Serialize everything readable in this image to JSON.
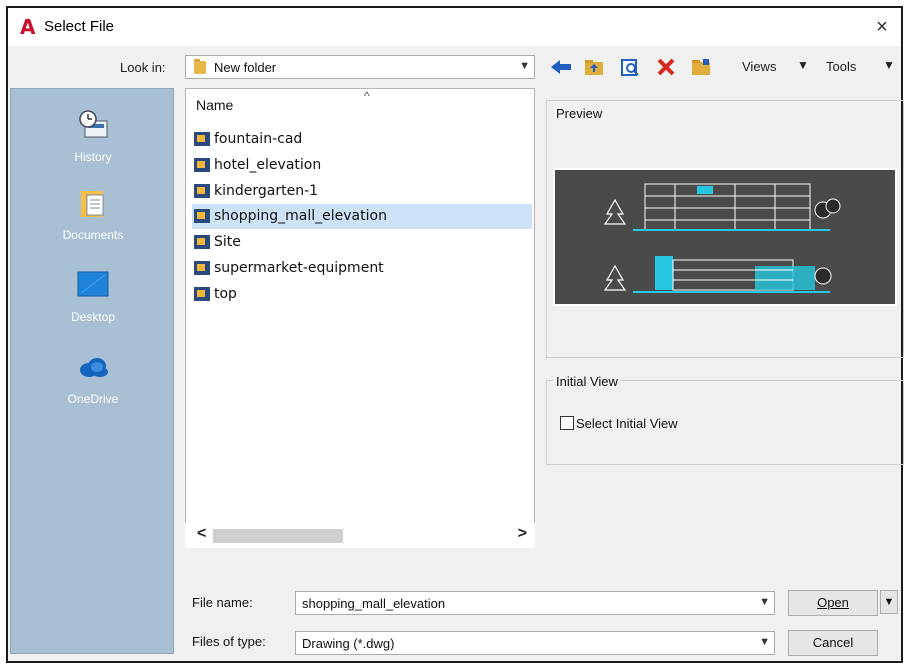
{
  "window": {
    "app_logo": "A",
    "title": "Select File",
    "close_glyph": "×"
  },
  "toolbar": {
    "look_in_label": "Look in:",
    "look_in_value": "New folder",
    "views_label": "Views",
    "tools_label": "Tools",
    "icons": [
      "back-arrow-icon",
      "up-folder-icon",
      "search-web-icon",
      "delete-icon",
      "create-folder-icon"
    ]
  },
  "places": [
    {
      "label": "History",
      "icon": "history-icon"
    },
    {
      "label": "Documents",
      "icon": "documents-icon"
    },
    {
      "label": "Desktop",
      "icon": "desktop-icon"
    },
    {
      "label": "OneDrive",
      "icon": "onedrive-icon"
    }
  ],
  "file_list": {
    "column_header": "Name",
    "files": [
      {
        "name": "fountain-cad",
        "selected": false
      },
      {
        "name": "hotel_elevation",
        "selected": false
      },
      {
        "name": "kindergarten-1",
        "selected": false
      },
      {
        "name": "shopping_mall_elevation",
        "selected": true
      },
      {
        "name": "Site",
        "selected": false
      },
      {
        "name": "supermarket-equipment",
        "selected": false
      },
      {
        "name": "top",
        "selected": false
      }
    ]
  },
  "preview": {
    "title": "Preview"
  },
  "initial_view": {
    "title": "Initial View",
    "checkbox_label": "Select Initial View",
    "checked": false
  },
  "bottom": {
    "file_name_label": "File name:",
    "file_name_value": "shopping_mall_elevation",
    "files_of_type_label": "Files of type:",
    "files_of_type_value": "Drawing (*.dwg)",
    "open_label": "Open",
    "cancel_label": "Cancel"
  },
  "colors": {
    "places_bg": "#a8bfd4",
    "selection_bg": "#cce3f7",
    "app_logo": "#c8102e"
  }
}
